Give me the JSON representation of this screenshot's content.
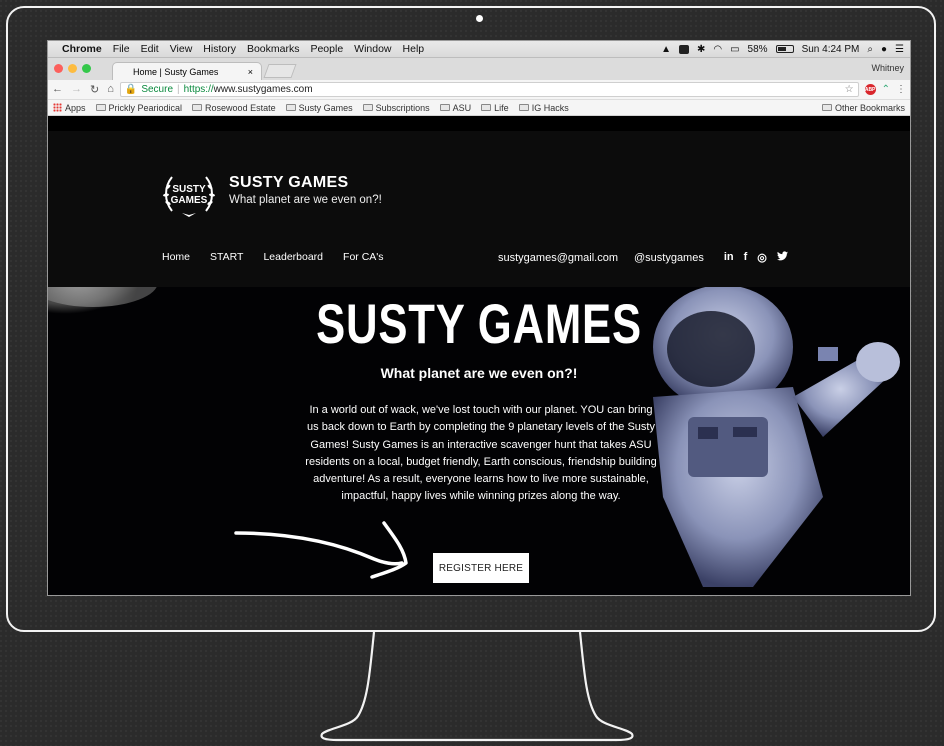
{
  "menubar": {
    "app_name": "Chrome",
    "items": [
      "File",
      "Edit",
      "View",
      "History",
      "Bookmarks",
      "People",
      "Window",
      "Help"
    ],
    "battery": "58%",
    "clock": "Sun 4:24 PM"
  },
  "browser": {
    "tab_title": "Home | Susty Games",
    "tab_close": "×",
    "profile": "Whitney",
    "secure_label": "Secure",
    "url_protocol": "https://",
    "url_host": "www.sustygames.com",
    "bookmarks": [
      "Apps",
      "Prickly Peariodical",
      "Rosewood Estate",
      "Susty Games",
      "Subscriptions",
      "ASU",
      "Life",
      "IG Hacks"
    ],
    "other_bookmarks": "Other Bookmarks",
    "abp_label": "ABP"
  },
  "site": {
    "logo_text": "SUSTY GAMES",
    "brand_name": "SUSTY GAMES",
    "brand_tagline": "What planet are we even on?!",
    "nav": [
      "Home",
      "START",
      "Leaderboard",
      "For CA's"
    ],
    "email": "sustygames@gmail.com",
    "handle": "@sustygames",
    "social": {
      "linkedin": "in",
      "facebook": "f",
      "instagram": "◎",
      "twitter": "🐦"
    }
  },
  "hero": {
    "title": "SUSTY GAMES",
    "subtitle": "What planet are we even on?!",
    "body": "In a world out of wack, we've lost touch with our planet. YOU can bring us back down to Earth by completing the 9 planetary levels of the Susty Games! Susty Games is an interactive scavenger hunt that takes ASU residents on a local, budget friendly, Earth conscious, friendship building adventure! As a result, everyone learns how to live more sustainable, impactful, happy lives while winning prizes along the way.",
    "cta": "REGISTER HERE"
  }
}
